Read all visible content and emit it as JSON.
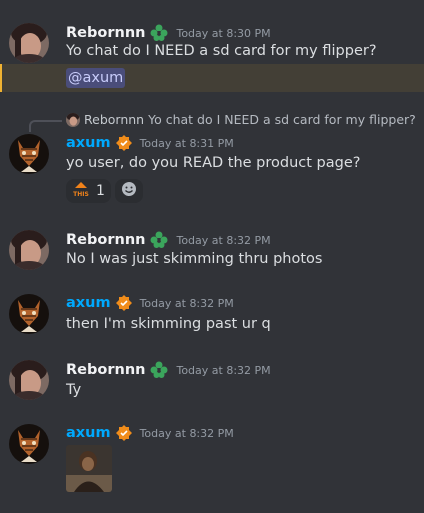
{
  "colors": {
    "background": "#313338",
    "axum_name": "#00a8fc",
    "reborn_name": "#f2f3f5",
    "timestamp": "#949ba4",
    "mention_bg": "#4a4d7a"
  },
  "messages": [
    {
      "author": "Rebornnn",
      "timestamp": "Today at 8:30 PM",
      "text": "Yo chat do I NEED a sd card for my flipper?",
      "mention": "@axum"
    },
    {
      "reply_author": "Rebornnn",
      "reply_text": "Yo chat do I NEED a sd card for my flipper?",
      "author": "axum",
      "timestamp": "Today at 8:31 PM",
      "text": "yo user, do you READ the product page?",
      "reaction_count": "1"
    },
    {
      "author": "Rebornnn",
      "timestamp": "Today at 8:32 PM",
      "text": "No I was just skimming thru photos"
    },
    {
      "author": "axum",
      "timestamp": "Today at 8:32 PM",
      "text": "then I'm skimming past ur q"
    },
    {
      "author": "Rebornnn",
      "timestamp": "Today at 8:32 PM",
      "text": "Ty"
    },
    {
      "author": "axum",
      "timestamp": "Today at 8:32 PM",
      "attachment": "image"
    }
  ]
}
